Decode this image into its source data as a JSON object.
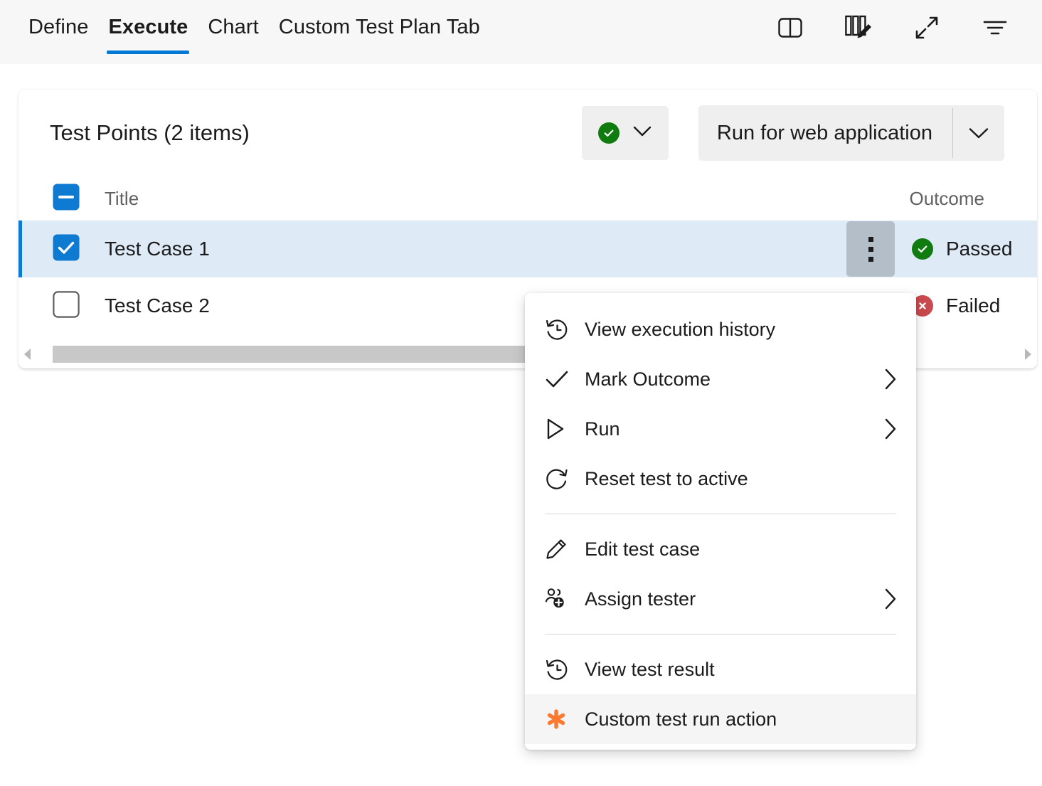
{
  "tabbar": {
    "tabs": [
      {
        "label": "Define",
        "active": false
      },
      {
        "label": "Execute",
        "active": true
      },
      {
        "label": "Chart",
        "active": false
      },
      {
        "label": "Custom Test Plan Tab",
        "active": false
      }
    ],
    "actions": [
      {
        "name": "split-pane-icon",
        "label": "Split pane view"
      },
      {
        "name": "column-options-icon",
        "label": "Column options"
      },
      {
        "name": "expand-icon",
        "label": "Enter full screen"
      },
      {
        "name": "filter-icon",
        "label": "Filter"
      }
    ]
  },
  "card": {
    "title": "Test Points (2 items)",
    "outcome_button": {
      "status": "passed",
      "caret": "chevron-down"
    },
    "run_button": {
      "label": "Run for web application",
      "caret": "chevron-down"
    }
  },
  "grid": {
    "columns": {
      "title": "Title",
      "outcome": "Outcome"
    },
    "header_checkbox_state": "indeterminate",
    "rows": [
      {
        "title": "Test Case 1",
        "outcome": "Passed",
        "outcome_state": "passed",
        "checked": true,
        "selected": true,
        "kebab_open": true
      },
      {
        "title": "Test Case 2",
        "outcome": "Failed",
        "outcome_state": "failed",
        "checked": false,
        "selected": false,
        "kebab_open": false
      }
    ]
  },
  "context_menu": {
    "items": [
      {
        "label": "View execution history",
        "icon": "history-icon",
        "submenu": false,
        "highlight": false
      },
      {
        "label": "Mark Outcome",
        "icon": "checkmark-icon",
        "submenu": true,
        "highlight": false
      },
      {
        "label": "Run",
        "icon": "play-icon",
        "submenu": true,
        "highlight": false
      },
      {
        "label": "Reset test to active",
        "icon": "refresh-icon",
        "submenu": false,
        "highlight": false
      },
      {
        "separator": true
      },
      {
        "label": "Edit test case",
        "icon": "pencil-icon",
        "submenu": false,
        "highlight": false
      },
      {
        "label": "Assign tester",
        "icon": "person-add-icon",
        "submenu": true,
        "highlight": false
      },
      {
        "separator": true
      },
      {
        "label": "View test result",
        "icon": "history-icon",
        "submenu": false,
        "highlight": false
      },
      {
        "label": "Custom test run action",
        "icon": "asterisk-icon",
        "submenu": false,
        "highlight": true
      }
    ]
  },
  "colors": {
    "accent": "#0078D4",
    "selected_row": "#DEEBF7",
    "pass_green": "#107C10",
    "fail_red": "#C94A4F",
    "custom_orange": "#FA7A32",
    "header_bg": "#F7F7F7"
  },
  "scrollbar": {
    "left_arrow": "◀",
    "right_arrow": "▶"
  }
}
